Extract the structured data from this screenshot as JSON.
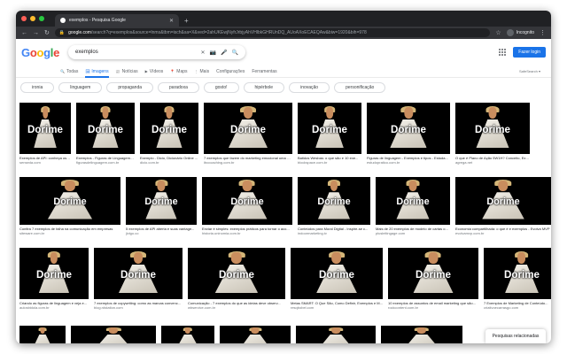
{
  "browser": {
    "tab_title": "exemplos - Pesquisa Google",
    "url_host": "google.com",
    "url_path": "/search?q=exemplos&source=lnms&tbm=isch&sa=X&ved=2ahUKEwjNyfrJrbjyAhVHlbkGHRUnDQ_AUoAXoECAEQAw&biw=1920&bih=978",
    "profile_label": "Incognito"
  },
  "google": {
    "logo_letters": [
      "G",
      "o",
      "o",
      "g",
      "l",
      "e"
    ],
    "logo_colors": [
      "#4285f4",
      "#ea4335",
      "#fbbc05",
      "#4285f4",
      "#34a853",
      "#ea4335"
    ],
    "search_value": "exemplos",
    "login_label": "Fazer login",
    "tabs": [
      {
        "icon": "🔍",
        "label": "Todas",
        "active": false
      },
      {
        "icon": "🖼",
        "label": "Imagens",
        "active": true
      },
      {
        "icon": "📰",
        "label": "Notícias",
        "active": false
      },
      {
        "icon": "▶",
        "label": "Vídeos",
        "active": false
      },
      {
        "icon": "📍",
        "label": "Maps",
        "active": false
      },
      {
        "icon": "⋮",
        "label": "Mais",
        "active": false
      },
      {
        "icon": "",
        "label": "Configurações",
        "active": false
      },
      {
        "icon": "",
        "label": "Ferramentas",
        "active": false
      }
    ],
    "safesearch_label": "SafeSearch ▾",
    "chips": [
      "ironia",
      "linguagem",
      "propaganda",
      "paradoxa",
      "gosto!",
      "hipérbole",
      "inovação",
      "personificação"
    ],
    "related_label": "Pesquisas relacionadas"
  },
  "results": [
    {
      "title": "Exemplos de API: conheça os 9 ...",
      "source": "senseda.com",
      "word": "Dorime"
    },
    {
      "title": "Exemplos - Figuras de Linguagem | Brasil",
      "source": "figurasdelinguagem.com.br",
      "word": "Dorime"
    },
    {
      "title": "Exemplo - Dicio, Dicionário Online ...",
      "source": "dicio.com.br",
      "word": "Dorime"
    },
    {
      "title": "7 exemplos que fazem do marketing emocional uma es...",
      "source": "ibccoaching.com.br",
      "word": "Dorime"
    },
    {
      "title": "Batidos Wesbas: o que são e 10 exe...",
      "source": "blockspace.com.br",
      "word": "Dorime"
    },
    {
      "title": "Figuras de linguagem - Exemplos e tipos - Estuda...",
      "source": "estudopratico.com.br",
      "word": "Dorime"
    },
    {
      "title": "O que é Plano de Ação 5W1H? Conceito, Exe...",
      "source": "agrega.net",
      "word": "Dorime"
    },
    {
      "title": "Confira 7 exemplos de falha na comunicação em empresas",
      "source": "siteware.com.br",
      "word": "Dorime"
    },
    {
      "title": "5 exemplos de API aberta e suas vantage...",
      "source": "jivigo.co",
      "word": "Dorime"
    },
    {
      "title": "Enviar é simples: exemplos práticos para tornar o aco...",
      "source": "historia.uninomia.com.br",
      "word": "Dorime"
    },
    {
      "title": "Conteúdos para Mural Digital - Inspire-se c...",
      "source": "indoormarketing.tv",
      "word": "Dorime"
    },
    {
      "title": "Mais de 20 exemplos de modelo de cartas o...",
      "source": "plusleitingage.com",
      "word": "Dorime"
    },
    {
      "title": "Economia compartilhada: o que é e exemplos - Evolva MVP",
      "source": "evolvamvp.com.br",
      "word": "Dorime"
    },
    {
      "title": "Criando as figuras de linguagem e veja e...",
      "source": "aulosbidola.com.br",
      "word": "Dorime"
    },
    {
      "title": "7 exemplos de copywriting: como as marcas convenc...",
      "source": "blog.rdstation.com",
      "word": "Dorime"
    },
    {
      "title": "Comunicação - 7 exemplos do que as ideias deve observ...",
      "source": "wbservice.com.br",
      "word": "Dorime"
    },
    {
      "title": "Metas SMART: O Que São, Como Definir, Exemplos e M...",
      "source": "resqbobel.com",
      "word": "Dorime"
    },
    {
      "title": "10 exemplos de assuntos de email marketing que são...",
      "source": "rockcontent.com.br",
      "word": "Dorime"
    },
    {
      "title": "7 Exemplos de Marketing de Conteúdo...",
      "source": "criativoecarrasgo.com",
      "word": "Dorime"
    }
  ]
}
